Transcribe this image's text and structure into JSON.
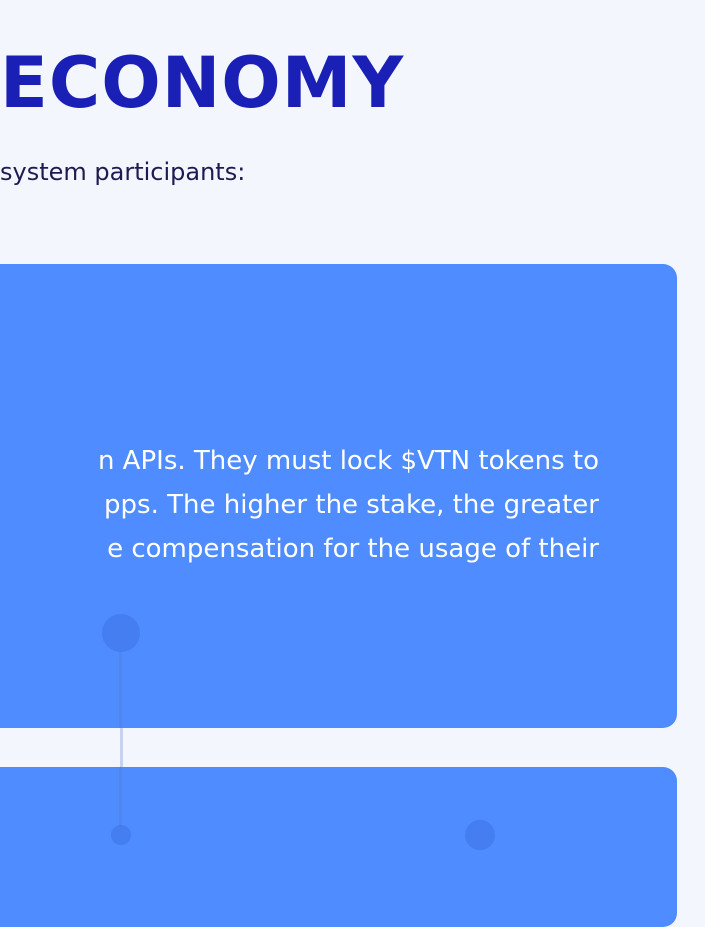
{
  "heading": "ECONOMY",
  "intro": "system participants:",
  "card1": {
    "lines": [
      "n APIs. They must lock $VTN tokens to",
      "pps. The higher the stake, the greater",
      "e compensation for the usage of their"
    ]
  },
  "colors": {
    "background": "#f4f6fe",
    "heading": "#1a1fb5",
    "body_text": "#1d1b52",
    "card": "#4f8cff",
    "card_text": "#ffffff"
  }
}
